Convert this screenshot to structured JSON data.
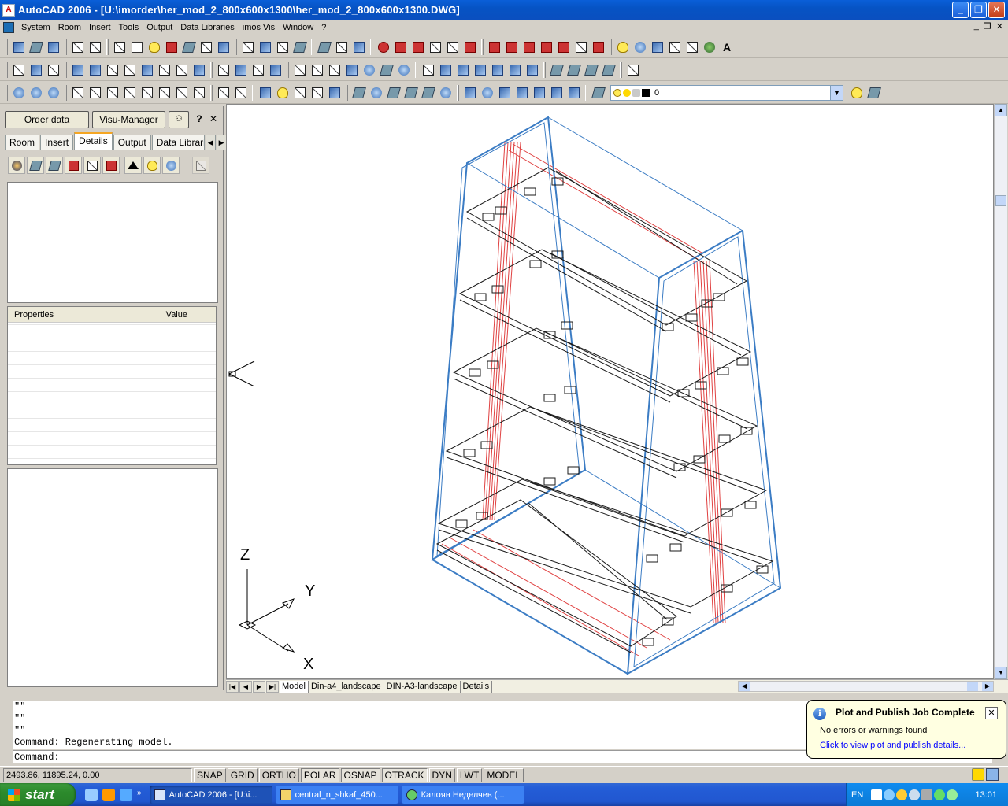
{
  "window": {
    "title": "AutoCAD 2006 - [U:\\imorder\\her_mod_2_800x600x1300\\her_mod_2_800x600x1300.DWG]",
    "app_icon": "A",
    "minimize": "_",
    "restore": "❐",
    "close": "✕"
  },
  "menu": {
    "items": [
      "System",
      "Room",
      "Insert",
      "Tools",
      "Output",
      "Data Libraries",
      "imos Vis",
      "Window",
      "?"
    ],
    "mdi_min": "_",
    "mdi_restore": "❐",
    "mdi_close": "✕"
  },
  "layer": {
    "current": "0"
  },
  "panel": {
    "order_data_button": "Order data",
    "visu_manager_button": "Visu-Manager",
    "help_button": "?",
    "close_button": "✕",
    "tabs": [
      "Room",
      "Insert",
      "Details",
      "Output",
      "Data Libraries"
    ],
    "active_tab": "Details",
    "properties_header": "Properties",
    "value_header": "Value"
  },
  "ucs": {
    "z": "Z",
    "y": "Y",
    "x": "X"
  },
  "layout_tabs": [
    "Model",
    "Din-a4_landscape",
    "DIN-A3-landscape",
    "Details"
  ],
  "command": {
    "history": [
      "\"\"",
      "\"\"",
      "\"\"",
      "Command: Regenerating model."
    ],
    "prompt": "Command:"
  },
  "status": {
    "coords": "2493.86, 11895.24, 0.00",
    "toggles": [
      "SNAP",
      "GRID",
      "ORTHO",
      "POLAR",
      "OSNAP",
      "OTRACK",
      "DYN",
      "LWT",
      "MODEL"
    ]
  },
  "notification": {
    "title": "Plot and Publish Job Complete",
    "message": "No errors or warnings found",
    "link": "Click to view plot and publish details..."
  },
  "taskbar": {
    "start": "start",
    "buttons": [
      "AutoCAD 2006 - [U:\\i...",
      "central_n_shkaf_450...",
      "Калоян Неделчев (..."
    ],
    "lang": "EN",
    "time": "13:01"
  },
  "colors": {
    "model_frame": "#3b7cc4",
    "model_red": "#e04040",
    "model_black": "#1a1a1a"
  }
}
